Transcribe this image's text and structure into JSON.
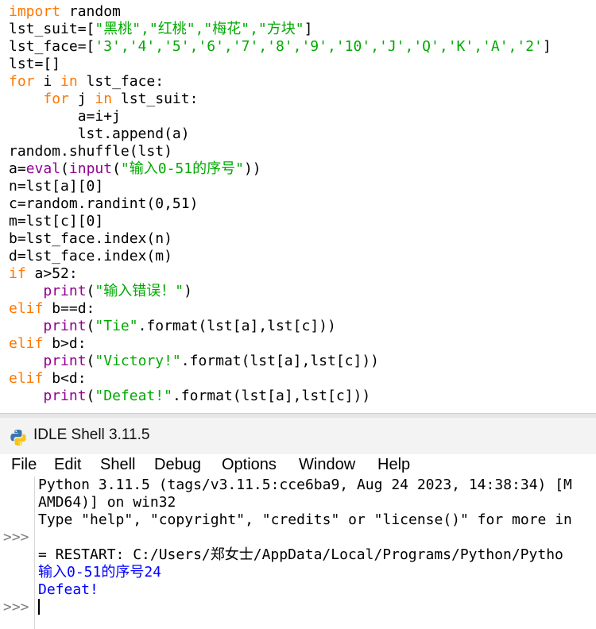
{
  "editor": {
    "lines": [
      [
        {
          "t": "import",
          "c": "kw"
        },
        {
          "t": " random"
        }
      ],
      [
        {
          "t": "lst_suit=["
        },
        {
          "t": "\"黑桃\",\"红桃\",\"梅花\",\"方块\"",
          "c": "st"
        },
        {
          "t": "]"
        }
      ],
      [
        {
          "t": "lst_face=["
        },
        {
          "t": "'3','4','5','6','7','8','9','10','J','Q','K','A','2'",
          "c": "st"
        },
        {
          "t": "]"
        }
      ],
      [
        {
          "t": "lst=[]"
        }
      ],
      [
        {
          "t": "for",
          "c": "kw"
        },
        {
          "t": " i "
        },
        {
          "t": "in",
          "c": "kw"
        },
        {
          "t": " lst_face:"
        }
      ],
      [
        {
          "t": "    "
        },
        {
          "t": "for",
          "c": "kw"
        },
        {
          "t": " j "
        },
        {
          "t": "in",
          "c": "kw"
        },
        {
          "t": " lst_suit:"
        }
      ],
      [
        {
          "t": "        a=i+j"
        }
      ],
      [
        {
          "t": "        lst.append(a)"
        }
      ],
      [
        {
          "t": "random.shuffle(lst)"
        }
      ],
      [
        {
          "t": "a="
        },
        {
          "t": "eval",
          "c": "bi"
        },
        {
          "t": "("
        },
        {
          "t": "input",
          "c": "bi"
        },
        {
          "t": "("
        },
        {
          "t": "\"输入0-51的序号\"",
          "c": "st"
        },
        {
          "t": "))"
        }
      ],
      [
        {
          "t": "n=lst[a][0]"
        }
      ],
      [
        {
          "t": "c=random.randint(0,51)"
        }
      ],
      [
        {
          "t": "m=lst[c][0]"
        }
      ],
      [
        {
          "t": "b=lst_face.index(n)"
        }
      ],
      [
        {
          "t": "d=lst_face.index(m)"
        }
      ],
      [
        {
          "t": "if",
          "c": "kw"
        },
        {
          "t": " a>52:"
        }
      ],
      [
        {
          "t": "    "
        },
        {
          "t": "print",
          "c": "bi"
        },
        {
          "t": "("
        },
        {
          "t": "\"输入错误！\"",
          "c": "st"
        },
        {
          "t": ")"
        }
      ],
      [
        {
          "t": "elif",
          "c": "kw"
        },
        {
          "t": " b==d:"
        }
      ],
      [
        {
          "t": "    "
        },
        {
          "t": "print",
          "c": "bi"
        },
        {
          "t": "("
        },
        {
          "t": "\"Tie\"",
          "c": "st"
        },
        {
          "t": ".format(lst[a],lst[c]))"
        }
      ],
      [
        {
          "t": "elif",
          "c": "kw"
        },
        {
          "t": " b>d:"
        }
      ],
      [
        {
          "t": "    "
        },
        {
          "t": "print",
          "c": "bi"
        },
        {
          "t": "("
        },
        {
          "t": "\"Victory!\"",
          "c": "st"
        },
        {
          "t": ".format(lst[a],lst[c]))"
        }
      ],
      [
        {
          "t": "elif",
          "c": "kw"
        },
        {
          "t": " b<d:"
        }
      ],
      [
        {
          "t": "    "
        },
        {
          "t": "print",
          "c": "bi"
        },
        {
          "t": "("
        },
        {
          "t": "\"Defeat!\"",
          "c": "st"
        },
        {
          "t": ".format(lst[a],lst[c]))"
        }
      ]
    ]
  },
  "shell": {
    "title": "IDLE Shell 3.11.5",
    "menu": [
      "File",
      "Edit",
      "Shell",
      "Debug",
      "Options",
      "Window",
      "Help"
    ],
    "prompt": ">>>",
    "lines": [
      {
        "text": "Python 3.11.5 (tags/v3.11.5:cce6ba9, Aug 24 2023, 14:38:34) [M",
        "style": "normal"
      },
      {
        "text": "AMD64)] on win32",
        "style": "normal"
      },
      {
        "text": "Type \"help\", \"copyright\", \"credits\" or \"license()\" for more in",
        "style": "normal"
      },
      {
        "text": "",
        "style": "normal"
      },
      {
        "text": "= RESTART: C:/Users/郑女士/AppData/Local/Programs/Python/Pytho",
        "style": "normal"
      },
      {
        "text": "输入0-51的序号24",
        "style": "blue"
      },
      {
        "text": "Defeat!",
        "style": "blue"
      }
    ]
  },
  "colors": {
    "keyword": "#ff7700",
    "builtin": "#900090",
    "string": "#00aa00",
    "shell_output": "#0000ff",
    "prompt": "#7f7f7f"
  },
  "icons": {
    "app": "python-logo-icon"
  }
}
